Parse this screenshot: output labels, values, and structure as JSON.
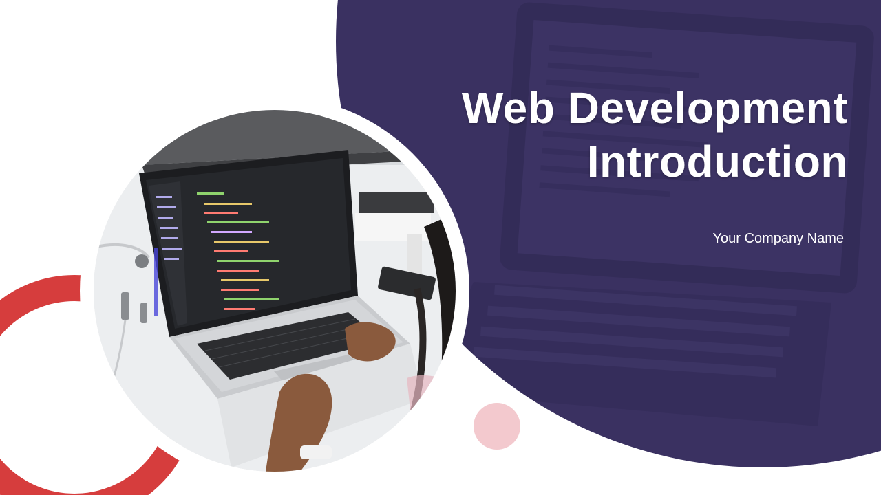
{
  "slide": {
    "title_line1": "Web Development",
    "title_line2": "Introduction",
    "company_name": "Your Company Name"
  },
  "colors": {
    "navy": "#3a3161",
    "red": "#d63d3d",
    "pink": "#f3c9ce",
    "white": "#ffffff"
  },
  "image": {
    "subject": "laptop-photo"
  }
}
